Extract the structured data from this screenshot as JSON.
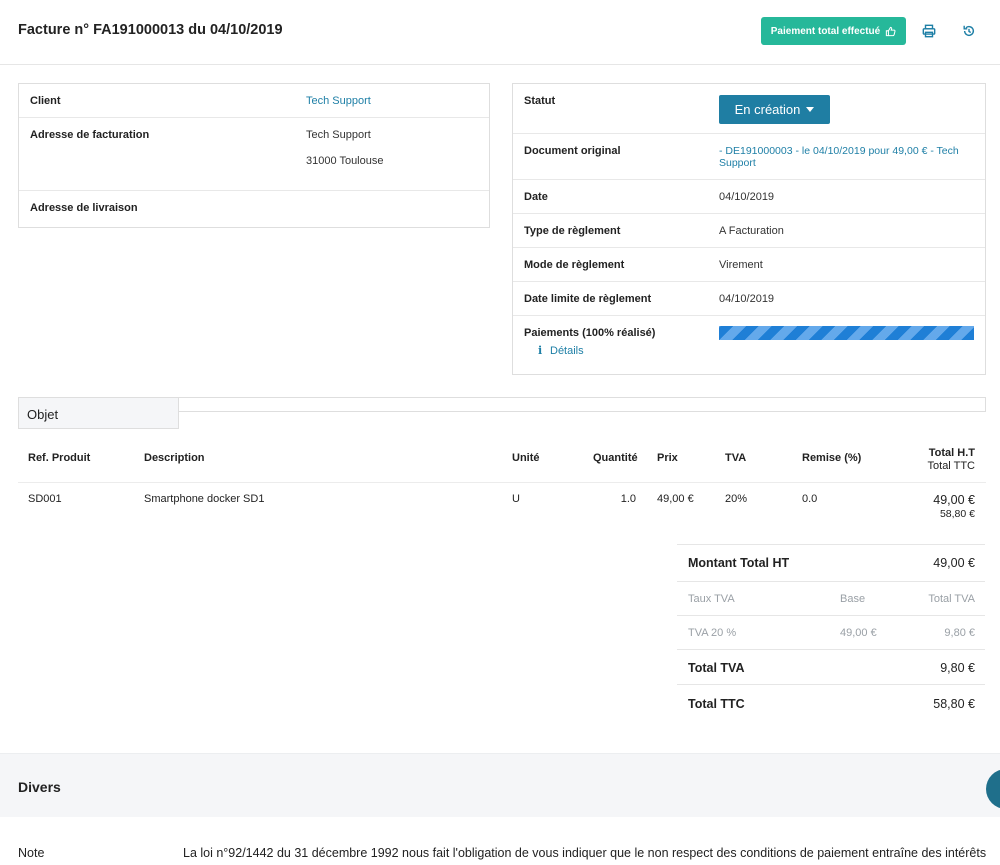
{
  "header": {
    "title": "Facture n° FA191000013 du 04/10/2019",
    "paid_button": "Paiement total effectué",
    "print_icon": "printer-icon",
    "history_icon": "history-icon",
    "accent_color": "#26b89a"
  },
  "client_box": {
    "client_label": "Client",
    "client_value": "Tech Support",
    "billing_label": "Adresse de facturation",
    "billing_line1": "Tech Support",
    "billing_line2": "31000 Toulouse",
    "delivery_label": "Adresse de livraison"
  },
  "info_box": {
    "status_label": "Statut",
    "status_value": "En création",
    "original_label": "Document original",
    "original_value": "- DE191000003 - le 04/10/2019 pour 49,00 € - Tech Support",
    "date_label": "Date",
    "date_value": "04/10/2019",
    "payment_type_label": "Type de règlement",
    "payment_type_value": "A Facturation",
    "payment_mode_label": "Mode de règlement",
    "payment_mode_value": "Virement",
    "due_date_label": "Date limite de règlement",
    "due_date_value": "04/10/2019",
    "payments_label": "Paiements (100% réalisé)",
    "payments_progress": 1.0,
    "details_link": "Détails"
  },
  "objet": {
    "tab_label": "Objet"
  },
  "table": {
    "headers": {
      "ref": "Ref. Produit",
      "description": "Description",
      "unit": "Unité",
      "quantity": "Quantité",
      "price": "Prix",
      "tva": "TVA",
      "discount": "Remise (%)",
      "total_ht": "Total H.T",
      "total_ttc": "Total TTC"
    },
    "rows": [
      {
        "ref": "SD001",
        "description": "Smartphone docker SD1",
        "unit": "U",
        "quantity": "1.0",
        "price": "49,00 €",
        "tva": "20%",
        "discount": "0.0",
        "total_ht": "49,00 €",
        "total_ttc": "58,80 €"
      }
    ]
  },
  "totals": {
    "total_ht_label": "Montant Total HT",
    "total_ht_value": "49,00 €",
    "tva_rate_header": "Taux TVA",
    "base_header": "Base",
    "tva_total_header": "Total TVA",
    "tva_line_rate": "TVA 20 %",
    "tva_line_base": "49,00 €",
    "tva_line_total": "9,80 €",
    "total_tva_label": "Total TVA",
    "total_tva_value": "9,80 €",
    "total_ttc_label": "Total TTC",
    "total_ttc_value": "58,80 €"
  },
  "divers": {
    "title": "Divers",
    "note_label": "Note",
    "note_text": "La loi n°92/1442 du 31 décembre 1992 nous fait l'obligation de vous indiquer que le non respect des conditions de paiement entraîne des intérêts"
  }
}
